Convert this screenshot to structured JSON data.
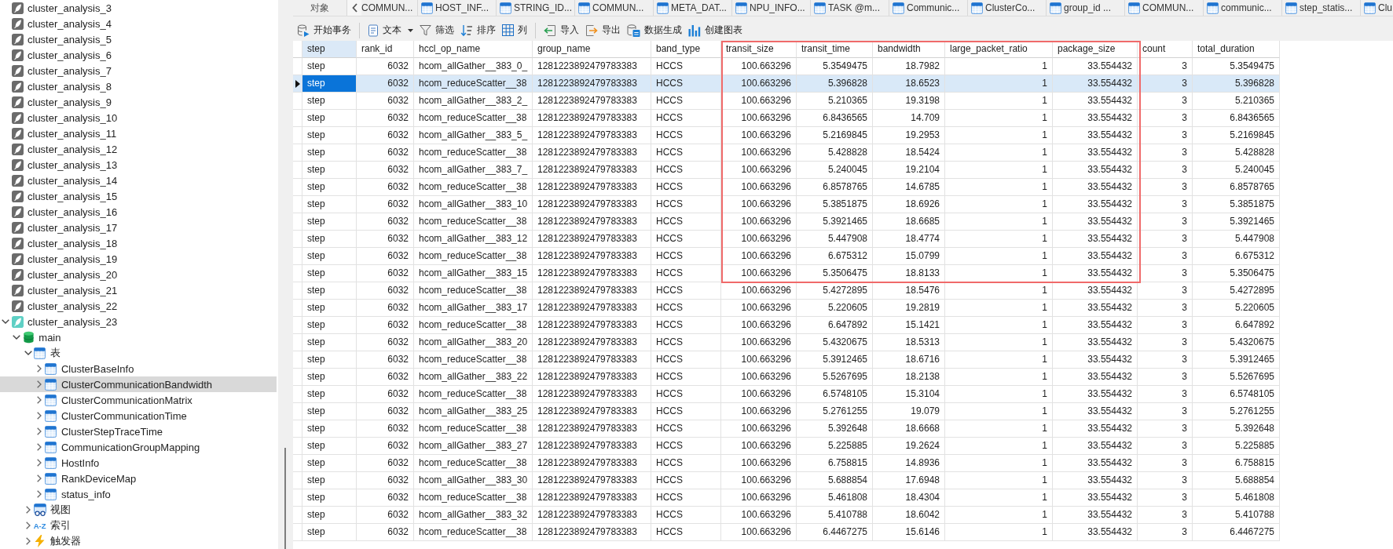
{
  "sidebar": {
    "items": [
      {
        "label": "cluster_analysis_3",
        "kind": "connection",
        "open": false,
        "expanded": false,
        "selected": false
      },
      {
        "label": "cluster_analysis_4",
        "kind": "connection",
        "open": false,
        "expanded": false,
        "selected": false
      },
      {
        "label": "cluster_analysis_5",
        "kind": "connection",
        "open": false,
        "expanded": false,
        "selected": false
      },
      {
        "label": "cluster_analysis_6",
        "kind": "connection",
        "open": false,
        "expanded": false,
        "selected": false
      },
      {
        "label": "cluster_analysis_7",
        "kind": "connection",
        "open": false,
        "expanded": false,
        "selected": false
      },
      {
        "label": "cluster_analysis_8",
        "kind": "connection",
        "open": false,
        "expanded": false,
        "selected": false
      },
      {
        "label": "cluster_analysis_9",
        "kind": "connection",
        "open": false,
        "expanded": false,
        "selected": false
      },
      {
        "label": "cluster_analysis_10",
        "kind": "connection",
        "open": false,
        "expanded": false,
        "selected": false
      },
      {
        "label": "cluster_analysis_11",
        "kind": "connection",
        "open": false,
        "expanded": false,
        "selected": false
      },
      {
        "label": "cluster_analysis_12",
        "kind": "connection",
        "open": false,
        "expanded": false,
        "selected": false
      },
      {
        "label": "cluster_analysis_13",
        "kind": "connection",
        "open": false,
        "expanded": false,
        "selected": false
      },
      {
        "label": "cluster_analysis_14",
        "kind": "connection",
        "open": false,
        "expanded": false,
        "selected": false
      },
      {
        "label": "cluster_analysis_15",
        "kind": "connection",
        "open": false,
        "expanded": false,
        "selected": false
      },
      {
        "label": "cluster_analysis_16",
        "kind": "connection",
        "open": false,
        "expanded": false,
        "selected": false
      },
      {
        "label": "cluster_analysis_17",
        "kind": "connection",
        "open": false,
        "expanded": false,
        "selected": false
      },
      {
        "label": "cluster_analysis_18",
        "kind": "connection",
        "open": false,
        "expanded": false,
        "selected": false
      },
      {
        "label": "cluster_analysis_19",
        "kind": "connection",
        "open": false,
        "expanded": false,
        "selected": false
      },
      {
        "label": "cluster_analysis_20",
        "kind": "connection",
        "open": false,
        "expanded": false,
        "selected": false
      },
      {
        "label": "cluster_analysis_21",
        "kind": "connection",
        "open": false,
        "expanded": false,
        "selected": false
      },
      {
        "label": "cluster_analysis_22",
        "kind": "connection",
        "open": false,
        "expanded": false,
        "selected": false
      },
      {
        "label": "cluster_analysis_23",
        "kind": "connection",
        "open": true,
        "expanded": true,
        "selected": false,
        "children": [
          {
            "label": "main",
            "kind": "database",
            "expanded": true,
            "selected": false,
            "children": [
              {
                "label": "表",
                "kind": "tables",
                "expanded": true,
                "selected": false,
                "children": [
                  {
                    "label": "ClusterBaseInfo",
                    "kind": "table",
                    "expanded": false,
                    "selected": false
                  },
                  {
                    "label": "ClusterCommunicationBandwidth",
                    "kind": "table",
                    "expanded": false,
                    "selected": true
                  },
                  {
                    "label": "ClusterCommunicationMatrix",
                    "kind": "table",
                    "expanded": false,
                    "selected": false
                  },
                  {
                    "label": "ClusterCommunicationTime",
                    "kind": "table",
                    "expanded": false,
                    "selected": false
                  },
                  {
                    "label": "ClusterStepTraceTime",
                    "kind": "table",
                    "expanded": false,
                    "selected": false
                  },
                  {
                    "label": "CommunicationGroupMapping",
                    "kind": "table",
                    "expanded": false,
                    "selected": false
                  },
                  {
                    "label": "HostInfo",
                    "kind": "table",
                    "expanded": false,
                    "selected": false
                  },
                  {
                    "label": "RankDeviceMap",
                    "kind": "table",
                    "expanded": false,
                    "selected": false
                  },
                  {
                    "label": "status_info",
                    "kind": "table",
                    "expanded": false,
                    "selected": false
                  }
                ]
              },
              {
                "label": "视图",
                "kind": "views",
                "expanded": false,
                "selected": false
              },
              {
                "label": "索引",
                "kind": "indexes",
                "icon_text": "A-Z",
                "expanded": false,
                "selected": false
              },
              {
                "label": "触发器",
                "kind": "triggers",
                "expanded": false,
                "selected": false
              }
            ]
          }
        ]
      }
    ]
  },
  "tab_bar": {
    "objects_tab": {
      "label": "对象",
      "selected": false
    },
    "tabs": [
      {
        "label": "COMMUN...",
        "icon_visible": false,
        "selected": false
      },
      {
        "label": "HOST_INF...",
        "icon_visible": true,
        "selected": false
      },
      {
        "label": "STRING_ID...",
        "icon_visible": true,
        "selected": false
      },
      {
        "label": "COMMUN...",
        "icon_visible": true,
        "selected": false
      },
      {
        "label": "META_DAT...",
        "icon_visible": true,
        "selected": false
      },
      {
        "label": "NPU_INFO...",
        "icon_visible": true,
        "selected": false
      },
      {
        "label": "TASK @m...",
        "icon_visible": true,
        "selected": false
      },
      {
        "label": "Communic...",
        "icon_visible": true,
        "selected": false
      },
      {
        "label": "ClusterCo...",
        "icon_visible": true,
        "selected": false
      },
      {
        "label": "group_id ...",
        "icon_visible": true,
        "selected": false
      },
      {
        "label": "COMMUN...",
        "icon_visible": true,
        "selected": false
      },
      {
        "label": "communic...",
        "icon_visible": true,
        "selected": false
      },
      {
        "label": "step_statis...",
        "icon_visible": true,
        "selected": false
      },
      {
        "label": "Clu",
        "icon_visible": true,
        "selected": false
      }
    ]
  },
  "toolbar": {
    "groups": [
      [
        {
          "label": "开始事务",
          "kind": "transaction",
          "dropdown": false
        }
      ],
      [
        {
          "label": "文本",
          "kind": "text",
          "dropdown": true
        },
        {
          "label": "筛选",
          "kind": "filter",
          "dropdown": false
        },
        {
          "label": "排序",
          "kind": "sort",
          "dropdown": false
        },
        {
          "label": "列",
          "kind": "columns",
          "dropdown": false
        }
      ],
      [
        {
          "label": "导入",
          "kind": "import",
          "dropdown": false
        },
        {
          "label": "导出",
          "kind": "export",
          "dropdown": false
        },
        {
          "label": "数据生成",
          "kind": "generate",
          "dropdown": false
        },
        {
          "label": "创建图表",
          "kind": "chart",
          "dropdown": false
        }
      ]
    ]
  },
  "table": {
    "columns": [
      {
        "label": "step",
        "kind": "text",
        "selected": true,
        "framed": false
      },
      {
        "label": "rank_id",
        "kind": "number",
        "selected": false,
        "framed": false
      },
      {
        "label": "hccl_op_name",
        "kind": "text",
        "selected": false,
        "framed": false
      },
      {
        "label": "group_name",
        "kind": "text",
        "selected": false,
        "framed": false
      },
      {
        "label": "band_type",
        "kind": "text",
        "selected": false,
        "framed": false
      },
      {
        "label": "transit_size",
        "kind": "number",
        "selected": false,
        "framed": true
      },
      {
        "label": "transit_time",
        "kind": "number",
        "selected": false,
        "framed": true
      },
      {
        "label": "bandwidth",
        "kind": "number",
        "selected": false,
        "framed": true
      },
      {
        "label": "large_packet_ratio",
        "kind": "number",
        "selected": false,
        "framed": true
      },
      {
        "label": "package_size",
        "kind": "number",
        "selected": false,
        "framed": true
      },
      {
        "label": "count",
        "kind": "number",
        "selected": false,
        "framed": false
      },
      {
        "label": "total_duration",
        "kind": "number",
        "selected": false,
        "framed": false
      }
    ],
    "framed_rows": [
      {
        "selected": false,
        "cells": [
          "step",
          "6032",
          "hcom_allGather__383_0_",
          "1281223892479783383",
          "HCCS",
          "100.663296",
          "5.3549475",
          "18.7982",
          "1",
          "33.554432",
          "3",
          "5.3549475"
        ]
      },
      {
        "selected": true,
        "cells": [
          "step",
          "6032",
          "hcom_reduceScatter__38",
          "1281223892479783383",
          "HCCS",
          "100.663296",
          "5.396828",
          "18.6523",
          "1",
          "33.554432",
          "3",
          "5.396828"
        ]
      },
      {
        "selected": false,
        "cells": [
          "step",
          "6032",
          "hcom_allGather__383_2_",
          "1281223892479783383",
          "HCCS",
          "100.663296",
          "5.210365",
          "19.3198",
          "1",
          "33.554432",
          "3",
          "5.210365"
        ]
      },
      {
        "selected": false,
        "cells": [
          "step",
          "6032",
          "hcom_reduceScatter__38",
          "1281223892479783383",
          "HCCS",
          "100.663296",
          "6.8436565",
          "14.709",
          "1",
          "33.554432",
          "3",
          "6.8436565"
        ]
      },
      {
        "selected": false,
        "cells": [
          "step",
          "6032",
          "hcom_allGather__383_5_",
          "1281223892479783383",
          "HCCS",
          "100.663296",
          "5.2169845",
          "19.2953",
          "1",
          "33.554432",
          "3",
          "5.2169845"
        ]
      },
      {
        "selected": false,
        "cells": [
          "step",
          "6032",
          "hcom_reduceScatter__38",
          "1281223892479783383",
          "HCCS",
          "100.663296",
          "5.428828",
          "18.5424",
          "1",
          "33.554432",
          "3",
          "5.428828"
        ]
      },
      {
        "selected": false,
        "cells": [
          "step",
          "6032",
          "hcom_allGather__383_7_",
          "1281223892479783383",
          "HCCS",
          "100.663296",
          "5.240045",
          "19.2104",
          "1",
          "33.554432",
          "3",
          "5.240045"
        ]
      },
      {
        "selected": false,
        "cells": [
          "step",
          "6032",
          "hcom_reduceScatter__38",
          "1281223892479783383",
          "HCCS",
          "100.663296",
          "6.8578765",
          "14.6785",
          "1",
          "33.554432",
          "3",
          "6.8578765"
        ]
      },
      {
        "selected": false,
        "cells": [
          "step",
          "6032",
          "hcom_allGather__383_10",
          "1281223892479783383",
          "HCCS",
          "100.663296",
          "5.3851875",
          "18.6926",
          "1",
          "33.554432",
          "3",
          "5.3851875"
        ]
      },
      {
        "selected": false,
        "cells": [
          "step",
          "6032",
          "hcom_reduceScatter__38",
          "1281223892479783383",
          "HCCS",
          "100.663296",
          "5.3921465",
          "18.6685",
          "1",
          "33.554432",
          "3",
          "5.3921465"
        ]
      },
      {
        "selected": false,
        "cells": [
          "step",
          "6032",
          "hcom_allGather__383_12",
          "1281223892479783383",
          "HCCS",
          "100.663296",
          "5.447908",
          "18.4774",
          "1",
          "33.554432",
          "3",
          "5.447908"
        ]
      },
      {
        "selected": false,
        "cells": [
          "step",
          "6032",
          "hcom_reduceScatter__38",
          "1281223892479783383",
          "HCCS",
          "100.663296",
          "6.675312",
          "15.0799",
          "1",
          "33.554432",
          "3",
          "6.675312"
        ]
      },
      {
        "selected": false,
        "cells": [
          "step",
          "6032",
          "hcom_allGather__383_15",
          "1281223892479783383",
          "HCCS",
          "100.663296",
          "5.3506475",
          "18.8133",
          "1",
          "33.554432",
          "3",
          "5.3506475"
        ]
      }
    ],
    "rows": [
      {
        "selected": false,
        "cells": [
          "step",
          "6032",
          "hcom_reduceScatter__38",
          "1281223892479783383",
          "HCCS",
          "100.663296",
          "5.4272895",
          "18.5476",
          "1",
          "33.554432",
          "3",
          "5.4272895"
        ]
      },
      {
        "selected": false,
        "cells": [
          "step",
          "6032",
          "hcom_allGather__383_17",
          "1281223892479783383",
          "HCCS",
          "100.663296",
          "5.220605",
          "19.2819",
          "1",
          "33.554432",
          "3",
          "5.220605"
        ]
      },
      {
        "selected": false,
        "cells": [
          "step",
          "6032",
          "hcom_reduceScatter__38",
          "1281223892479783383",
          "HCCS",
          "100.663296",
          "6.647892",
          "15.1421",
          "1",
          "33.554432",
          "3",
          "6.647892"
        ]
      },
      {
        "selected": false,
        "cells": [
          "step",
          "6032",
          "hcom_allGather__383_20",
          "1281223892479783383",
          "HCCS",
          "100.663296",
          "5.4320675",
          "18.5313",
          "1",
          "33.554432",
          "3",
          "5.4320675"
        ]
      },
      {
        "selected": false,
        "cells": [
          "step",
          "6032",
          "hcom_reduceScatter__38",
          "1281223892479783383",
          "HCCS",
          "100.663296",
          "5.3912465",
          "18.6716",
          "1",
          "33.554432",
          "3",
          "5.3912465"
        ]
      },
      {
        "selected": false,
        "cells": [
          "step",
          "6032",
          "hcom_allGather__383_22",
          "1281223892479783383",
          "HCCS",
          "100.663296",
          "5.5267695",
          "18.2138",
          "1",
          "33.554432",
          "3",
          "5.5267695"
        ]
      },
      {
        "selected": false,
        "cells": [
          "step",
          "6032",
          "hcom_reduceScatter__38",
          "1281223892479783383",
          "HCCS",
          "100.663296",
          "6.5748105",
          "15.3104",
          "1",
          "33.554432",
          "3",
          "6.5748105"
        ]
      },
      {
        "selected": false,
        "cells": [
          "step",
          "6032",
          "hcom_allGather__383_25",
          "1281223892479783383",
          "HCCS",
          "100.663296",
          "5.2761255",
          "19.079",
          "1",
          "33.554432",
          "3",
          "5.2761255"
        ]
      },
      {
        "selected": false,
        "cells": [
          "step",
          "6032",
          "hcom_reduceScatter__38",
          "1281223892479783383",
          "HCCS",
          "100.663296",
          "5.392648",
          "18.6668",
          "1",
          "33.554432",
          "3",
          "5.392648"
        ]
      },
      {
        "selected": false,
        "cells": [
          "step",
          "6032",
          "hcom_allGather__383_27",
          "1281223892479783383",
          "HCCS",
          "100.663296",
          "5.225885",
          "19.2624",
          "1",
          "33.554432",
          "3",
          "5.225885"
        ]
      },
      {
        "selected": false,
        "cells": [
          "step",
          "6032",
          "hcom_reduceScatter__38",
          "1281223892479783383",
          "HCCS",
          "100.663296",
          "6.758815",
          "14.8936",
          "1",
          "33.554432",
          "3",
          "6.758815"
        ]
      },
      {
        "selected": false,
        "cells": [
          "step",
          "6032",
          "hcom_allGather__383_30",
          "1281223892479783383",
          "HCCS",
          "100.663296",
          "5.688854",
          "17.6948",
          "1",
          "33.554432",
          "3",
          "5.688854"
        ]
      },
      {
        "selected": false,
        "cells": [
          "step",
          "6032",
          "hcom_reduceScatter__38",
          "1281223892479783383",
          "HCCS",
          "100.663296",
          "5.461808",
          "18.4304",
          "1",
          "33.554432",
          "3",
          "5.461808"
        ]
      },
      {
        "selected": false,
        "cells": [
          "step",
          "6032",
          "hcom_allGather__383_32",
          "1281223892479783383",
          "HCCS",
          "100.663296",
          "5.410788",
          "18.6042",
          "1",
          "33.554432",
          "3",
          "5.410788"
        ]
      },
      {
        "selected": false,
        "cells": [
          "step",
          "6032",
          "hcom_reduceScatter__38",
          "1281223892479783383",
          "HCCS",
          "100.663296",
          "6.4467275",
          "15.6146",
          "1",
          "33.554432",
          "3",
          "6.4467275"
        ]
      }
    ]
  }
}
